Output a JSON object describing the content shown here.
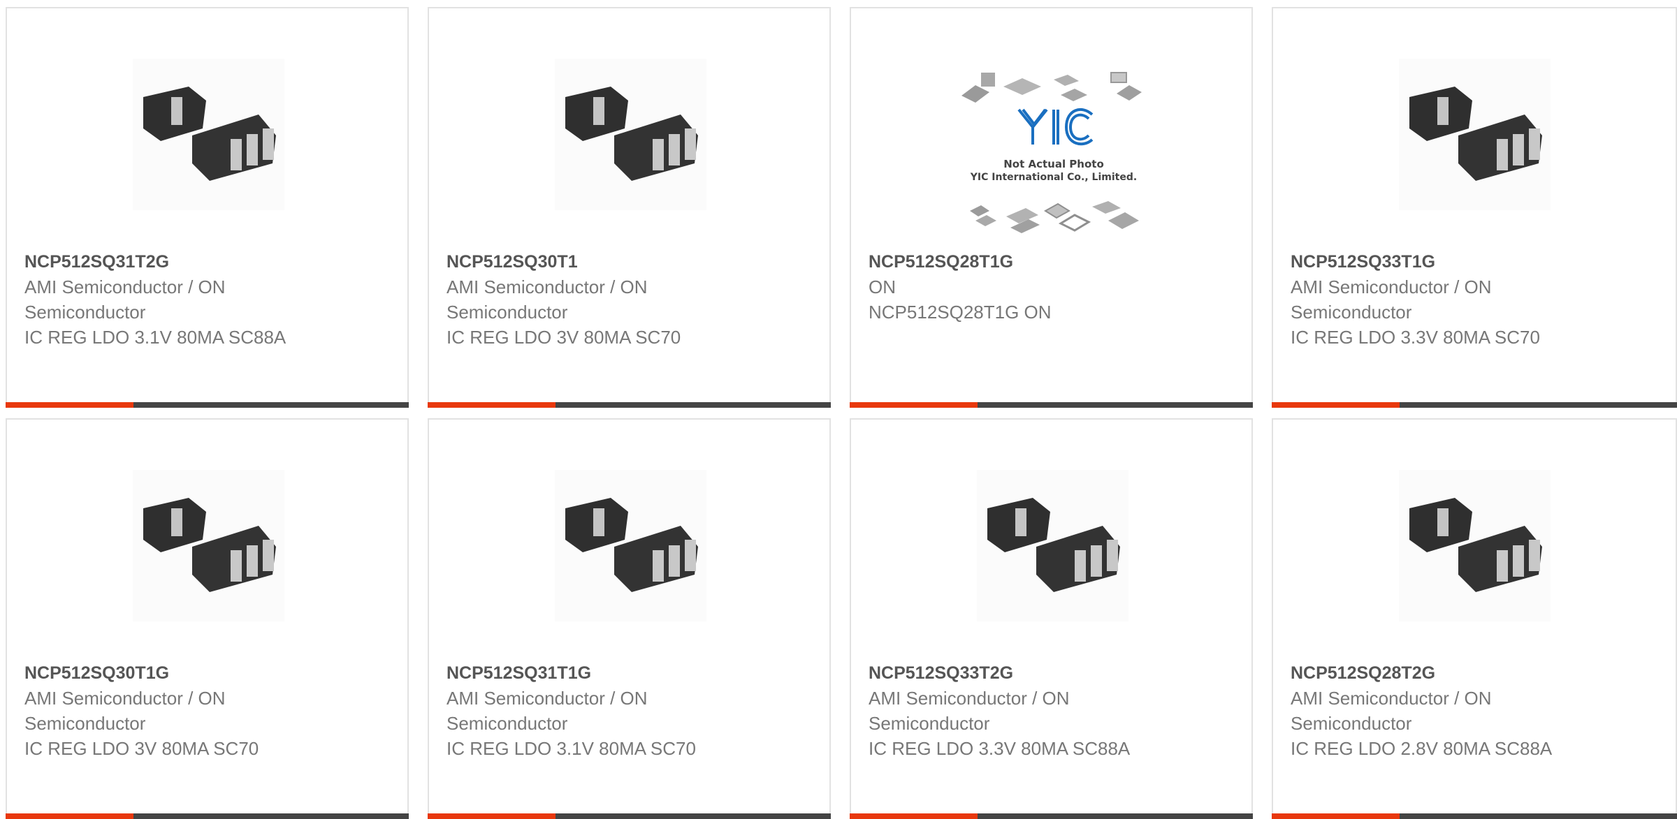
{
  "products": [
    {
      "part_number": "NCP512SQ31T2G",
      "manufacturer": "AMI Semiconductor / ON Semiconductor",
      "description": "IC REG LDO 3.1V 80MA SC88A",
      "image": "sot-chip-photo"
    },
    {
      "part_number": "NCP512SQ30T1",
      "manufacturer": "AMI Semiconductor / ON Semiconductor",
      "description": "IC REG LDO 3V 80MA SC70",
      "image": "sot-chip-photo"
    },
    {
      "part_number": "NCP512SQ28T1G",
      "manufacturer": "ON",
      "description": "NCP512SQ28T1G ON",
      "image": "not-actual-photo-placeholder",
      "placeholder_text": [
        "YIC",
        "Not Actual Photo",
        "YIC International Co., Limited."
      ]
    },
    {
      "part_number": "NCP512SQ33T1G",
      "manufacturer": "AMI Semiconductor / ON Semiconductor",
      "description": "IC REG LDO 3.3V 80MA SC70",
      "image": "sot-chip-photo"
    },
    {
      "part_number": "NCP512SQ30T1G",
      "manufacturer": "AMI Semiconductor / ON Semiconductor",
      "description": "IC REG LDO 3V 80MA SC70",
      "image": "sot-chip-photo"
    },
    {
      "part_number": "NCP512SQ31T1G",
      "manufacturer": "AMI Semiconductor / ON Semiconductor",
      "description": "IC REG LDO 3.1V 80MA SC70",
      "image": "sot-chip-photo"
    },
    {
      "part_number": "NCP512SQ33T2G",
      "manufacturer": "AMI Semiconductor / ON Semiconductor",
      "description": "IC REG LDO 3.3V 80MA SC88A",
      "image": "sot-chip-photo"
    },
    {
      "part_number": "NCP512SQ28T2G",
      "manufacturer": "AMI Semiconductor / ON Semiconductor",
      "description": "IC REG LDO 2.8V 80MA SC88A",
      "image": "sot-chip-photo"
    }
  ],
  "colors": {
    "accent": "#e8380d",
    "bar": "#444444",
    "part_number": "#555555",
    "body_text": "#777777",
    "card_border": "#e2e2e2",
    "logo_blue": "#1a6fc0"
  }
}
